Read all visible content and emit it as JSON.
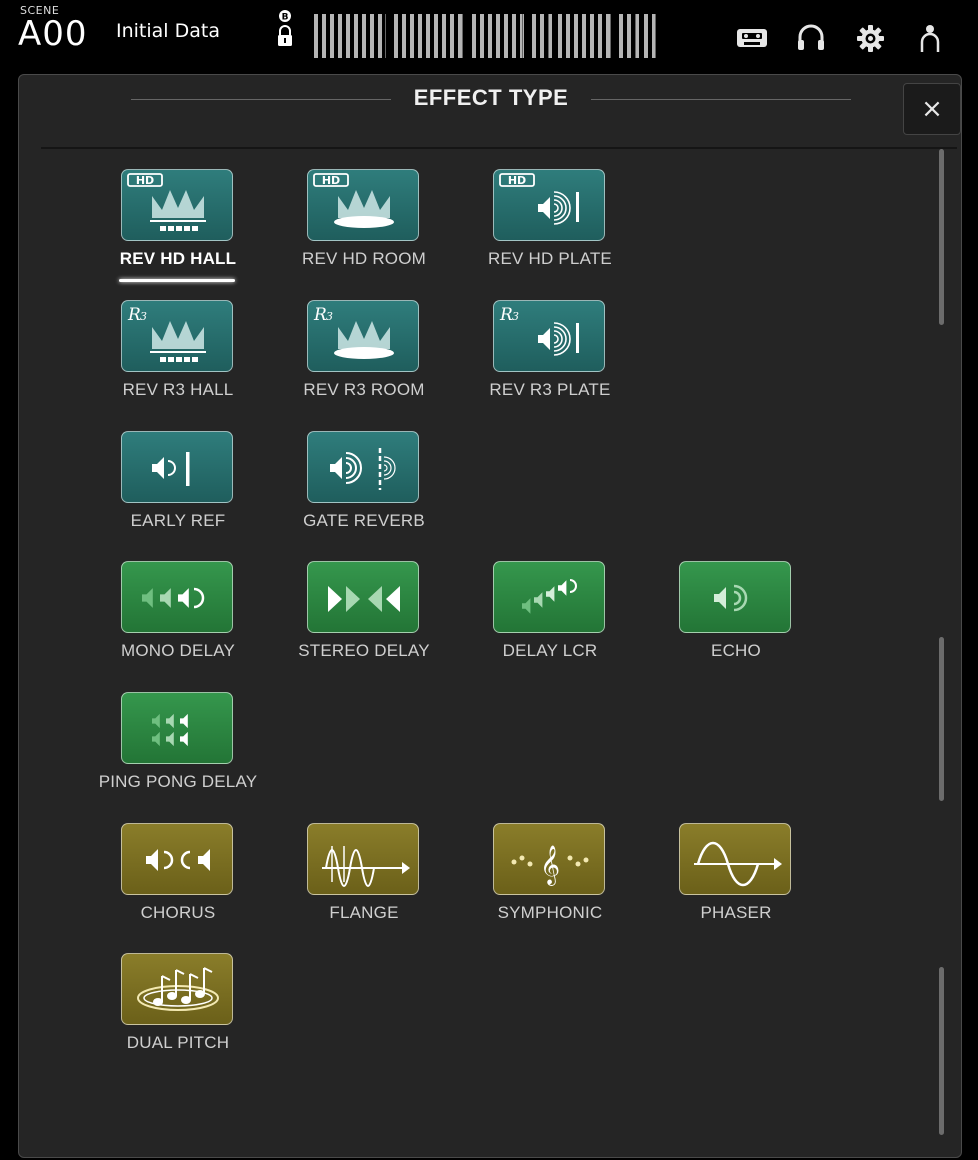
{
  "topbar": {
    "scene_label": "SCENE",
    "scene_number": "A00",
    "scene_name": "Initial Data",
    "icons": [
      "lock-icon",
      "recorder-icon",
      "headphones-icon",
      "settings-gear-icon",
      "user-icon"
    ]
  },
  "panel": {
    "title": "EFFECT TYPE",
    "close_symbol": "×"
  },
  "colors": {
    "reverb": "#2a7372",
    "delay": "#2e8a44",
    "modulation": "#7d7122",
    "selected_text": "#ffffff",
    "label_text": "#cfcfcf"
  },
  "effects": [
    {
      "label": "REV HD HALL",
      "category": "reverb",
      "icon": "hd-hall-icon",
      "selected": true
    },
    {
      "label": "REV HD ROOM",
      "category": "reverb",
      "icon": "hd-room-icon",
      "selected": false
    },
    {
      "label": "REV HD PLATE",
      "category": "reverb",
      "icon": "hd-plate-icon",
      "selected": false
    },
    {
      "label": "REV R3 HALL",
      "category": "reverb",
      "icon": "r3-hall-icon",
      "selected": false
    },
    {
      "label": "REV R3 ROOM",
      "category": "reverb",
      "icon": "r3-room-icon",
      "selected": false
    },
    {
      "label": "REV R3 PLATE",
      "category": "reverb",
      "icon": "r3-plate-icon",
      "selected": false
    },
    {
      "label": "EARLY REF",
      "category": "reverb",
      "icon": "early-ref-icon",
      "selected": false
    },
    {
      "label": "GATE REVERB",
      "category": "reverb",
      "icon": "gate-reverb-icon",
      "selected": false
    },
    {
      "label": "MONO DELAY",
      "category": "delay",
      "icon": "mono-delay-icon",
      "selected": false
    },
    {
      "label": "STEREO DELAY",
      "category": "delay",
      "icon": "stereo-delay-icon",
      "selected": false
    },
    {
      "label": "DELAY LCR",
      "category": "delay",
      "icon": "delay-lcr-icon",
      "selected": false
    },
    {
      "label": "ECHO",
      "category": "delay",
      "icon": "echo-icon",
      "selected": false
    },
    {
      "label": "PING PONG DELAY",
      "category": "delay",
      "icon": "ping-pong-delay-icon",
      "selected": false
    },
    {
      "label": "CHORUS",
      "category": "modulation",
      "icon": "chorus-icon",
      "selected": false
    },
    {
      "label": "FLANGE",
      "category": "modulation",
      "icon": "flange-icon",
      "selected": false
    },
    {
      "label": "SYMPHONIC",
      "category": "modulation",
      "icon": "symphonic-icon",
      "selected": false
    },
    {
      "label": "PHASER",
      "category": "modulation",
      "icon": "phaser-icon",
      "selected": false
    },
    {
      "label": "DUAL PITCH",
      "category": "modulation",
      "icon": "dual-pitch-icon",
      "selected": false
    }
  ]
}
